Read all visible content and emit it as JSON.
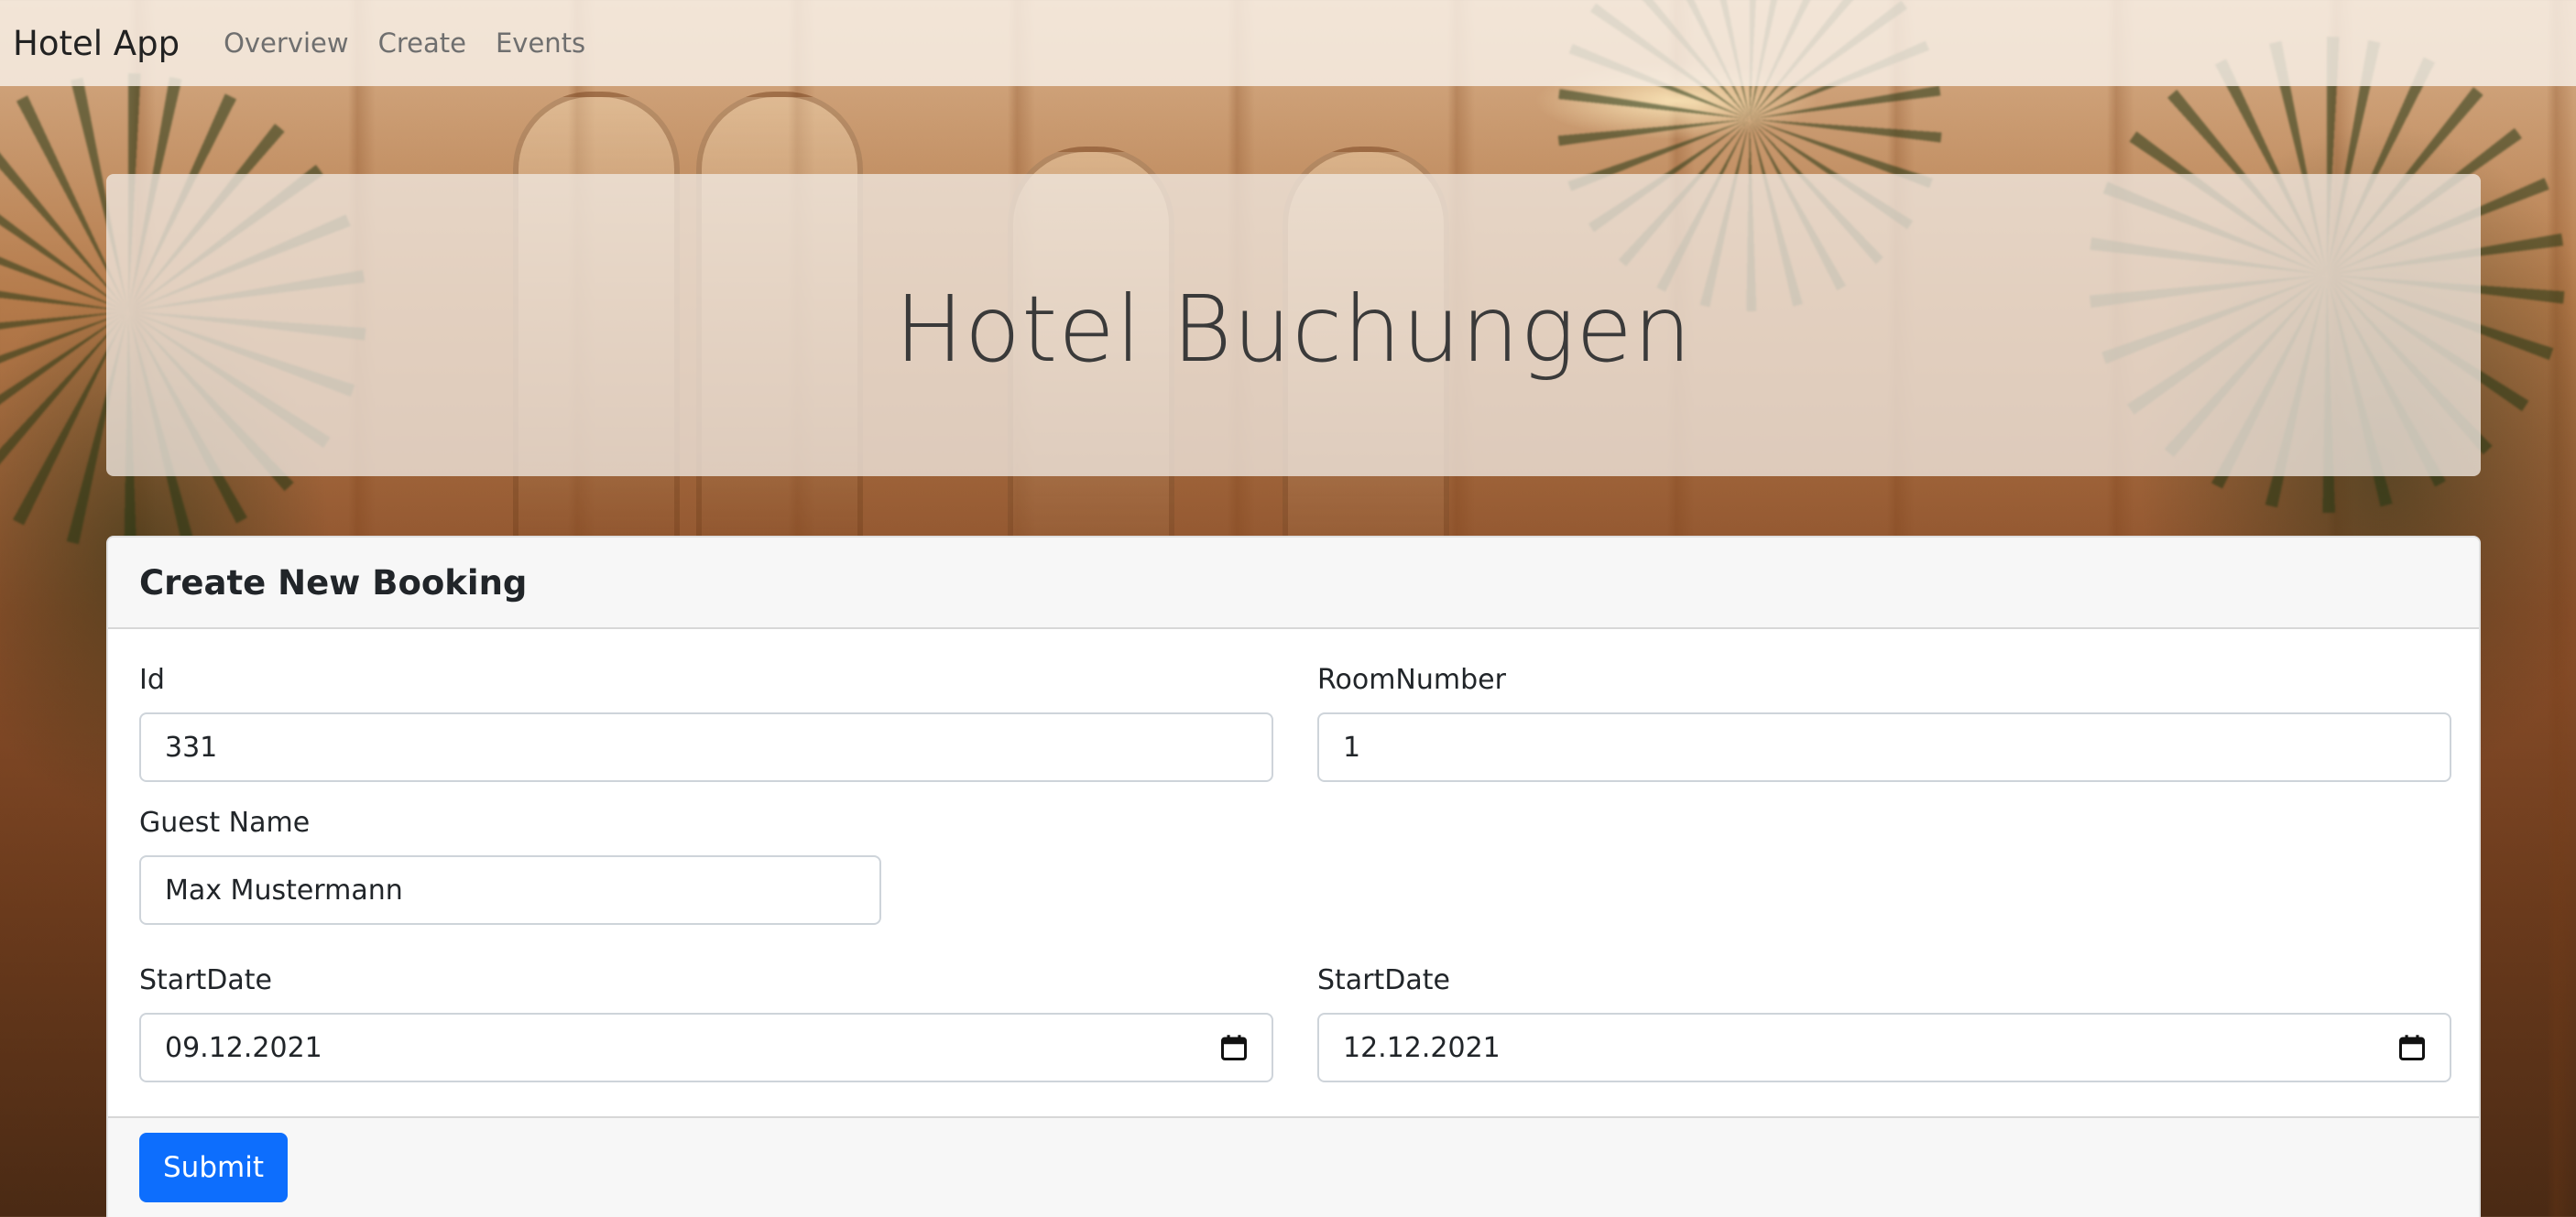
{
  "navbar": {
    "brand": "Hotel App",
    "links": [
      "Overview",
      "Create",
      "Events"
    ]
  },
  "hero": {
    "title": "Hotel Buchungen"
  },
  "form": {
    "title": "Create New Booking",
    "fields": {
      "id": {
        "label": "Id",
        "value": "331"
      },
      "room_number": {
        "label": "RoomNumber",
        "value": "1"
      },
      "guest_name": {
        "label": "Guest Name",
        "value": "Max Mustermann"
      },
      "start_date": {
        "label": "StartDate",
        "value": "09.12.2021",
        "icon": "calendar-icon"
      },
      "end_date": {
        "label": "StartDate",
        "value": "12.12.2021",
        "icon": "calendar-icon"
      }
    },
    "submit_label": "Submit"
  },
  "colors": {
    "primary": "#0d6efd",
    "text": "#212529",
    "nav_link": "#6f6f6f",
    "card_header_bg": "#f7f7f7"
  }
}
